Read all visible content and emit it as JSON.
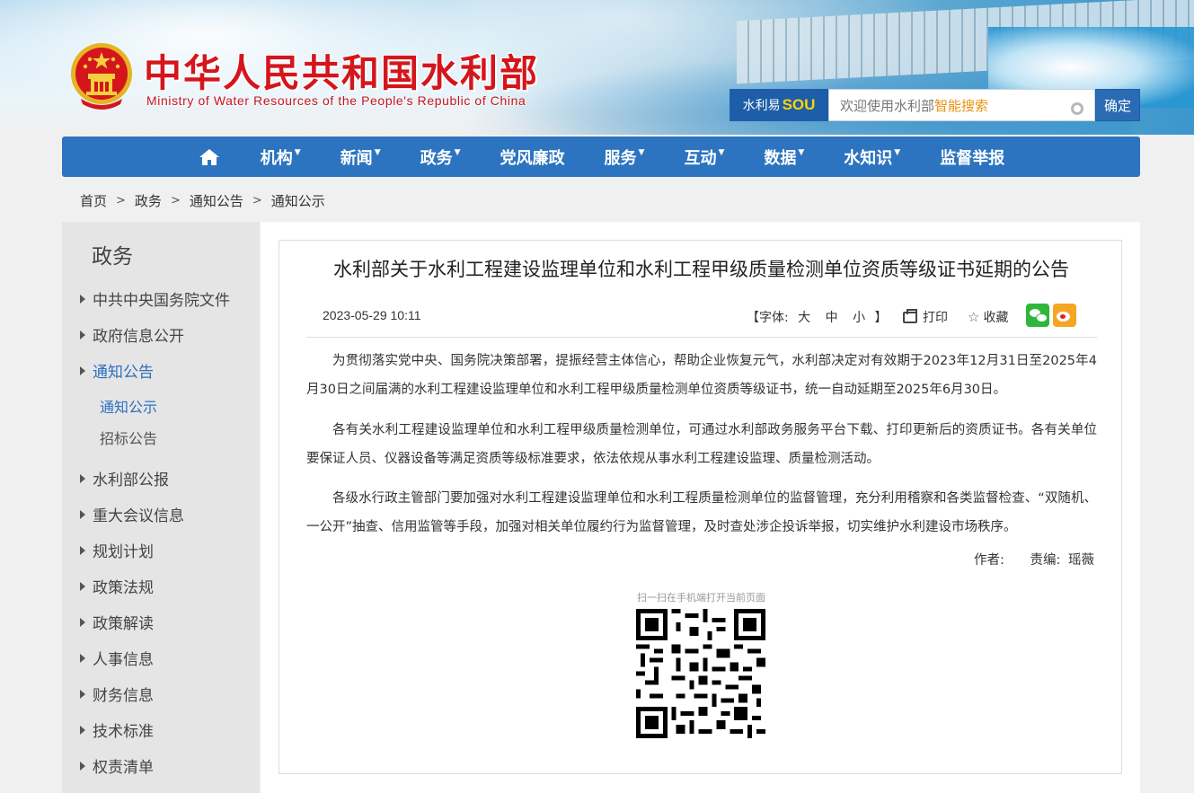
{
  "header": {
    "title": "中华人民共和国水利部",
    "subtitle": "Ministry of Water Resources of the People's Republic of China"
  },
  "search": {
    "brand_prefix": "水利易",
    "brand_logo": "SOU",
    "placeholder_main": "欢迎使用水利部",
    "placeholder_highlight": "智能搜索",
    "button_label": "确定"
  },
  "nav": {
    "items": [
      {
        "label": "机构",
        "has_dropdown": true
      },
      {
        "label": "新闻",
        "has_dropdown": true
      },
      {
        "label": "政务",
        "has_dropdown": true
      },
      {
        "label": "党风廉政",
        "has_dropdown": false
      },
      {
        "label": "服务",
        "has_dropdown": true
      },
      {
        "label": "互动",
        "has_dropdown": true
      },
      {
        "label": "数据",
        "has_dropdown": true
      },
      {
        "label": "水知识",
        "has_dropdown": true
      },
      {
        "label": "监督举报",
        "has_dropdown": false
      }
    ]
  },
  "breadcrumb": [
    "首页",
    "政务",
    "通知公告",
    "通知公示"
  ],
  "sidebar": {
    "title": "政务",
    "items": [
      {
        "label": "中共中央国务院文件"
      },
      {
        "label": "政府信息公开"
      },
      {
        "label": "通知公告",
        "active": true
      },
      {
        "label": "水利部公报"
      },
      {
        "label": "重大会议信息"
      },
      {
        "label": "规划计划"
      },
      {
        "label": "政策法规"
      },
      {
        "label": "政策解读"
      },
      {
        "label": "人事信息"
      },
      {
        "label": "财务信息"
      },
      {
        "label": "技术标准"
      },
      {
        "label": "权责清单"
      }
    ],
    "subitems": [
      {
        "label": "通知公示",
        "active": true
      },
      {
        "label": "招标公告"
      }
    ]
  },
  "article": {
    "title": "水利部关于水利工程建设监理单位和水利工程甲级质量检测单位资质等级证书延期的公告",
    "date": "2023-05-29 10:11",
    "font_label_open": "【字体:",
    "font_large": "大",
    "font_medium": "中",
    "font_small": "小",
    "font_label_close": "】",
    "print_label": "打印",
    "favorite_label": "收藏",
    "paragraphs": [
      "为贯彻落实党中央、国务院决策部署，提振经营主体信心，帮助企业恢复元气，水利部决定对有效期于2023年12月31日至2025年4月30日之间届满的水利工程建设监理单位和水利工程甲级质量检测单位资质等级证书，统一自动延期至2025年6月30日。",
      "各有关水利工程建设监理单位和水利工程甲级质量检测单位，可通过水利部政务服务平台下载、打印更新后的资质证书。各有关单位要保证人员、仪器设备等满足资质等级标准要求，依法依规从事水利工程建设监理、质量检测活动。",
      "各级水行政主管部门要加强对水利工程建设监理单位和水利工程质量检测单位的监督管理，充分利用稽察和各类监督检查、“双随机、一公开”抽查、信用监管等手段，加强对相关单位履约行为监督管理，及时查处涉企投诉举报，切实维护水利建设市场秩序。"
    ],
    "author_label": "作者:",
    "editor_label": "责编:",
    "editor_name": "瑶薇",
    "qr_caption": "扫一扫在手机端打开当前页面"
  },
  "icons": {
    "home": "home-icon",
    "print": "printer-icon",
    "favorite": "star-icon",
    "wechat": "wechat-icon",
    "weibo": "weibo-icon",
    "search_settings": "gear-icon"
  },
  "colors": {
    "nav_bg": "#2c74c0",
    "title_red": "#d4161c",
    "active_blue": "#2c6fbf",
    "search_brand_bg": "#1e5ea8",
    "highlight_orange": "#e8920e"
  }
}
